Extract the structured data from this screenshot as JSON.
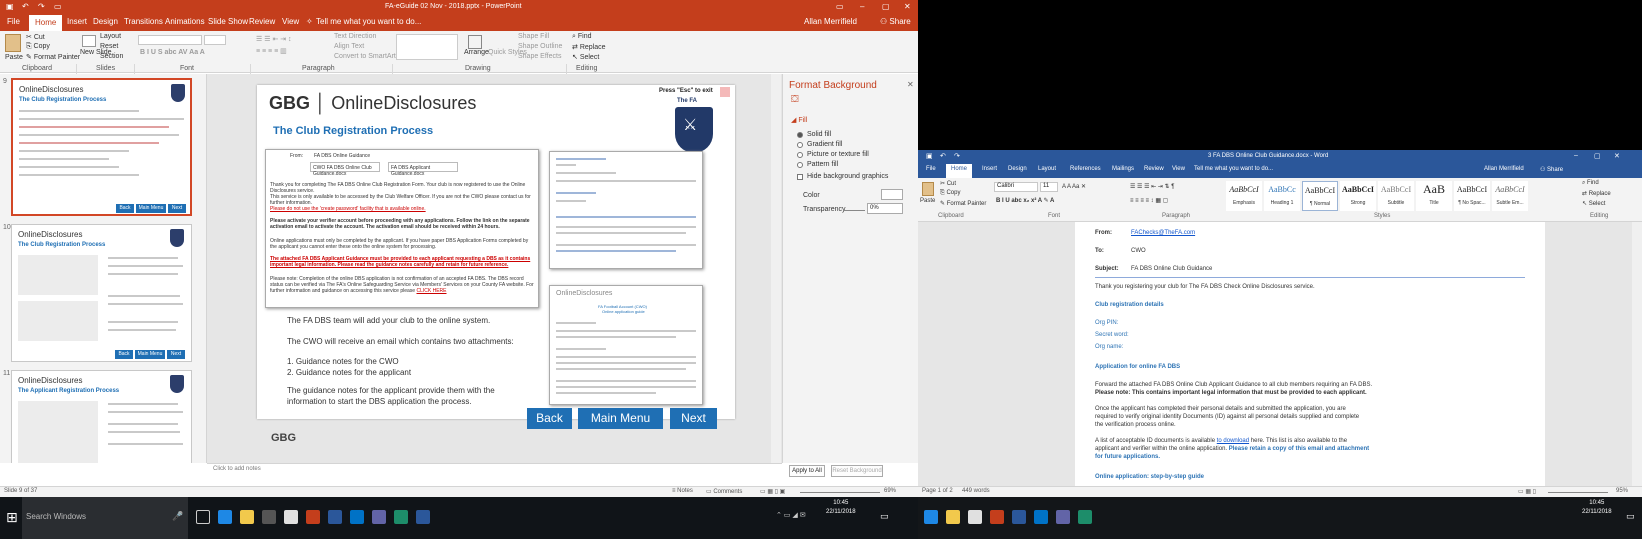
{
  "ppt": {
    "title": "FA-eGuide 02 Nov - 2018.pptx - PowerPoint",
    "user": "Allan Merrifield",
    "share": "Share",
    "tabs": [
      "File",
      "Home",
      "Insert",
      "Design",
      "Transitions",
      "Animations",
      "Slide Show",
      "Review",
      "View"
    ],
    "tell_me": "Tell me what you want to do...",
    "ribbon": {
      "paste": "Paste",
      "cut": "Cut",
      "copy": "Copy",
      "format_painter": "Format Painter",
      "new_slide": "New Slide",
      "layout": "Layout",
      "reset": "Reset",
      "section": "Section",
      "text_direction": "Text Direction",
      "align_text": "Align Text",
      "convert_smartart": "Convert to SmartArt",
      "arrange": "Arrange",
      "quick_styles": "Quick Styles",
      "shape_fill": "Shape Fill",
      "shape_outline": "Shape Outline",
      "shape_effects": "Shape Effects",
      "find": "Find",
      "replace": "Replace",
      "select": "Select",
      "groups": [
        "Clipboard",
        "Slides",
        "Font",
        "Paragraph",
        "Drawing",
        "Editing"
      ]
    },
    "thumbs": [
      {
        "num": "9",
        "title": "The Club Registration Process",
        "buttons": [
          "Back",
          "Main Menu",
          "Next"
        ]
      },
      {
        "num": "10",
        "title": "The Club Registration Process",
        "buttons": [
          "Back",
          "Main Menu",
          "Next"
        ]
      },
      {
        "num": "11",
        "title": "The Applicant Registration Process"
      }
    ],
    "slide": {
      "logo_a": "GBG",
      "logo_b": "OnlineDisclosures",
      "esc_hint": "Press \"Esc\" to exit",
      "crest_label": "The FA",
      "title": "The Club Registration Process",
      "mail": {
        "from_label": "From:",
        "from_value": "FA DBS Online Guidance",
        "att1": "CWO FA DBS Online Club Guidance.docx",
        "att2": "FA DBS Applicant Guidance.docx",
        "p1": "Thank you for completing The FA DBS Online Club Registration Form. Your club is now registered to use the Online Disclosures service.",
        "p2": "This service is only available to be accessed by the Club Welfare Officer. If you are not the CWO please contact us for further information.",
        "p3": "Please do not use the 'create password' facility that is available online.",
        "p4": "Please activate your verifier account before proceeding with any applications. Follow the link on the separate activation email to activate the account. The activation email should be received within 24 hours.",
        "p5": "Online applications must only be completed by the applicant. If you have paper DBS Application Forms completed by the applicant you cannot enter these onto the online system for processing.",
        "p6": "The attached FA DBS Applicant Guidance must be provided to each applicant requesting a DBS as it contains important legal information. Please read the guidance notes carefully and retain for future reference.",
        "p7": "Please note: Completion of the online DBS application is not confirmation of an accepted FA DBS. The DBS record status can be verified via The FA's Online Safeguarding Service via Members' Services on your County FA website. For further information and guidance on accessing this service please",
        "p7_link": "CLICK HERE"
      },
      "doc_header": "OnlineDisclosures",
      "doc_title": "FA Football Account (CWO)",
      "doc_subtitle": "Online application guide",
      "body1": "The FA DBS team will add your club to the online system.",
      "body2": "The CWO will receive an email which contains two attachments:",
      "list": [
        "1. Guidance notes for the CWO",
        "2. Guidance notes for the applicant"
      ],
      "body3": "The guidance notes for the applicant provide them with the",
      "body4": "information to start the DBS application the process.",
      "footer_logo": "GBG",
      "buttons": [
        "Back",
        "Main Menu",
        "Next"
      ]
    },
    "notes_hint": "Click to add notes",
    "format_bg": {
      "title": "Format Background",
      "section": "Fill",
      "options": [
        "Solid fill",
        "Gradient fill",
        "Picture or texture fill",
        "Pattern fill"
      ],
      "hide_graphics": "Hide background graphics",
      "color": "Color",
      "transparency": "Transparency",
      "transparency_value": "0%",
      "apply_all": "Apply to All",
      "reset": "Reset Background"
    },
    "status": {
      "slide_info": "Slide 9 of 37",
      "notes": "Notes",
      "comments": "Comments",
      "zoom": "69%"
    }
  },
  "word": {
    "title": "3 FA DBS Online Club Guidance.docx - Word",
    "user": "Allan Merrifield",
    "tabs": [
      "File",
      "Home",
      "Insert",
      "Design",
      "Layout",
      "References",
      "Mailings",
      "Review",
      "View"
    ],
    "tell_me": "Tell me what you want to do...",
    "ribbon": {
      "paste": "Paste",
      "cut": "Cut",
      "copy": "Copy",
      "format_painter": "Format Painter",
      "font_name": "Calibri",
      "font_size": "11",
      "find": "Find",
      "replace": "Replace",
      "select": "Select",
      "groups": [
        "Clipboard",
        "Font",
        "Paragraph",
        "Styles",
        "Editing"
      ]
    },
    "styles": [
      {
        "preview": "AaBbCcI",
        "name": "Emphasis"
      },
      {
        "preview": "AaBbCc",
        "name": "Heading 1"
      },
      {
        "preview": "AaBbCcI",
        "name": "¶ Normal"
      },
      {
        "preview": "AaBbCcI",
        "name": "Strong"
      },
      {
        "preview": "AaBbCcI",
        "name": "Subtitle"
      },
      {
        "preview": "AaB",
        "name": "Title"
      },
      {
        "preview": "AaBbCcI",
        "name": "¶ No Spac..."
      },
      {
        "preview": "AaBbCcI",
        "name": "Subtle Em..."
      }
    ],
    "doc": {
      "from_label": "From:",
      "from_value": "FAChecks@TheFA.com",
      "to_label": "To:",
      "to_value": "CWO",
      "subject_label": "Subject:",
      "subject_value": "FA DBS Online Club Guidance",
      "intro": "Thank you registering your club for The FA DBS Check Online Disclosures service.",
      "club_heading": "Club registration details",
      "org_pin": "Org PIN:",
      "secret_word": "Secret word:",
      "org_name": "Org name:",
      "app_heading": "Application for online FA DBS",
      "p1": "Forward the attached FA DBS Online Club Applicant Guidance to all club members requiring an FA DBS.",
      "p1b": "Please note: This contains important legal information that must be provided to each applicant.",
      "p2": "Once the applicant has completed their personal details and submitted the application, you are",
      "p2b": "required to verify original identity Documents (ID) against all personal details supplied and complete",
      "p2c": "the verification process online.",
      "p3": "A list of acceptable ID documents is available",
      "p3_link": "to download",
      "p3_rest": "here. This list is also available to the",
      "p3b": "applicant and verifier within the online application.",
      "p3b_blue": "Please retain a copy of this email and attachment",
      "p3c_blue": "for future applications.",
      "step_heading": "Online application: step-by-step guide"
    },
    "status": {
      "page": "Page 1 of 2",
      "words": "449 words",
      "zoom": "95%"
    }
  },
  "taskbar": {
    "search": "Search Windows",
    "time": "10:45",
    "date": "22/11/2018"
  },
  "colors": {
    "ppt_accent": "#c43e1c",
    "word_accent": "#2b579a",
    "fa_blue": "#1f6fb4"
  }
}
